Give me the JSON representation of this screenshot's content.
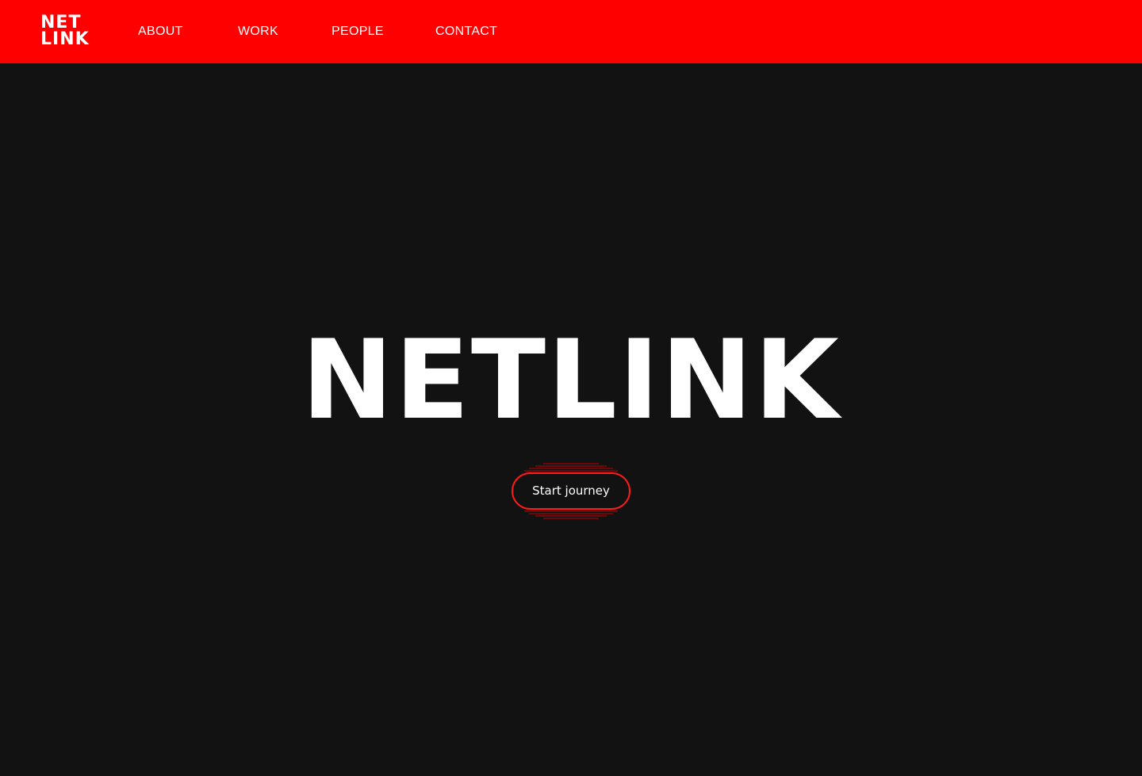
{
  "brand": {
    "logo_line1": "NET",
    "logo_line2": "LINK",
    "accent_color": "#ff0000",
    "background_color": "#121212"
  },
  "nav": {
    "items": [
      {
        "label": "ABOUT"
      },
      {
        "label": "WORK"
      },
      {
        "label": "PEOPLE"
      },
      {
        "label": "CONTACT"
      }
    ]
  },
  "hero": {
    "title": "NETLINK",
    "cta_label": "Start journey"
  }
}
